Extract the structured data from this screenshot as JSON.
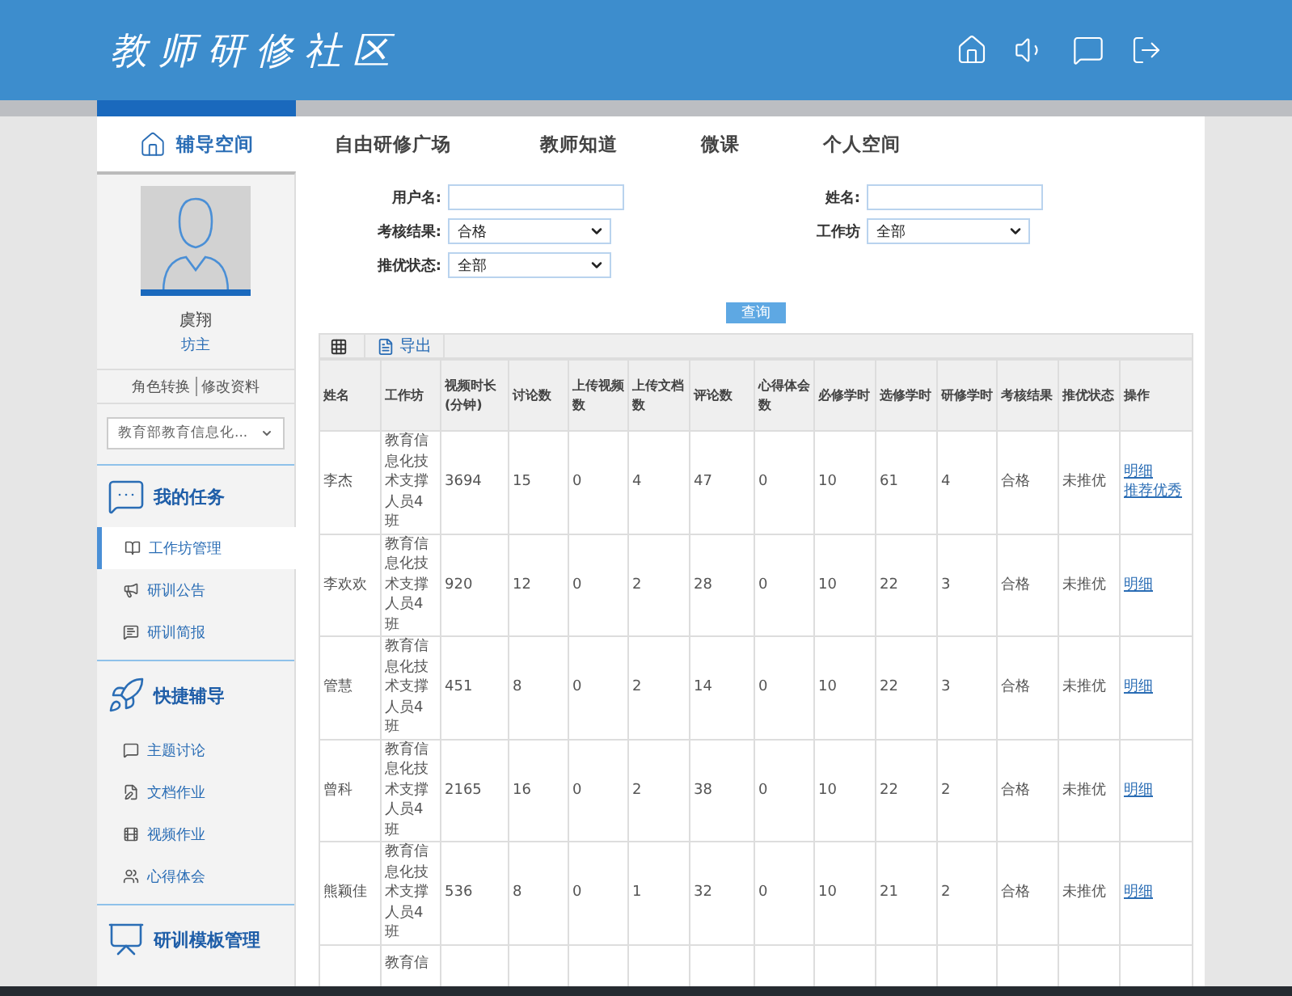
{
  "header": {
    "title": "教师研修社区"
  },
  "nav": [
    {
      "label": "辅导空间",
      "selected": true
    },
    {
      "label": "自由研修广场",
      "selected": false
    },
    {
      "label": "教师知道",
      "selected": false
    },
    {
      "label": "微课",
      "selected": false
    },
    {
      "label": "个人空间",
      "selected": false
    }
  ],
  "profile": {
    "name": "虞翔",
    "role": "坊主",
    "links": [
      "角色转换",
      "修改资料"
    ],
    "workshop_select": "教育部教育信息化..."
  },
  "sidebar": [
    {
      "title": "我的任务",
      "items": [
        {
          "label": "工作坊管理",
          "selected": true
        },
        {
          "label": "研训公告",
          "selected": false
        },
        {
          "label": "研训简报",
          "selected": false
        }
      ]
    },
    {
      "title": "快捷辅导",
      "items": [
        {
          "label": "主题讨论",
          "selected": false
        },
        {
          "label": "文档作业",
          "selected": false
        },
        {
          "label": "视频作业",
          "selected": false
        },
        {
          "label": "心得体会",
          "selected": false
        }
      ]
    },
    {
      "title": "研训模板管理"
    }
  ],
  "filters": [
    {
      "label": "用户名:",
      "kind": "text"
    },
    {
      "label": "姓名:",
      "kind": "text"
    },
    {
      "label": "考核结果:",
      "kind": "select",
      "value": "合格"
    },
    {
      "label": "工作坊",
      "kind": "select",
      "value": "全部"
    },
    {
      "label": "推优状态:",
      "kind": "select",
      "value": "全部"
    }
  ],
  "query_button": "查询",
  "table": {
    "toolbar": {
      "export": "导出"
    },
    "columns": [
      "姓名",
      "工作坊",
      "视频时长(分钟)",
      "讨论数",
      "上传视频数",
      "上传文档数",
      "评论数",
      "心得体会数",
      "必修学时",
      "选修学时",
      "研修学时",
      "考核结果",
      "推优状态",
      "操作"
    ],
    "rows": [
      {
        "cells": [
          "李杰",
          "教育信息化技术支撑人员4班",
          "3694",
          "15",
          "0",
          "4",
          "47",
          "0",
          "10",
          "61",
          "4",
          "合格",
          "未推优"
        ],
        "actions": [
          "明细",
          "推荐优秀"
        ]
      },
      {
        "cells": [
          "李欢欢",
          "教育信息化技术支撑人员4班",
          "920",
          "12",
          "0",
          "2",
          "28",
          "0",
          "10",
          "22",
          "3",
          "合格",
          "未推优"
        ],
        "actions": [
          "明细"
        ]
      },
      {
        "cells": [
          "管慧",
          "教育信息化技术支撑人员4班",
          "451",
          "8",
          "0",
          "2",
          "14",
          "0",
          "10",
          "22",
          "3",
          "合格",
          "未推优"
        ],
        "actions": [
          "明细"
        ]
      },
      {
        "cells": [
          "曾科",
          "教育信息化技术支撑人员4班",
          "2165",
          "16",
          "0",
          "2",
          "38",
          "0",
          "10",
          "22",
          "2",
          "合格",
          "未推优"
        ],
        "actions": [
          "明细"
        ]
      },
      {
        "cells": [
          "熊颖佳",
          "教育信息化技术支撑人员4班",
          "536",
          "8",
          "0",
          "1",
          "32",
          "0",
          "10",
          "21",
          "2",
          "合格",
          "未推优"
        ],
        "actions": [
          "明细"
        ]
      },
      {
        "cells": [
          null,
          "教育信"
        ],
        "actions": []
      }
    ]
  }
}
